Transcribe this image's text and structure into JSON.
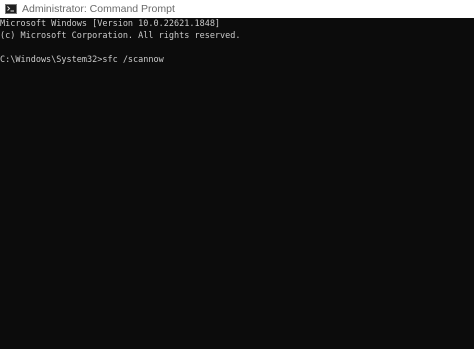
{
  "window": {
    "title": "Administrator: Command Prompt",
    "icon": "cmd-icon"
  },
  "console": {
    "lines": [
      "Microsoft Windows [Version 10.0.22621.1848]",
      "(c) Microsoft Corporation. All rights reserved.",
      "C:\\Windows\\System32>sfc /scannow"
    ]
  },
  "colors": {
    "console_background": "#0c0c0c",
    "console_text": "#cccccc",
    "titlebar_background": "#ffffff",
    "title_text": "#6a6a6a"
  }
}
